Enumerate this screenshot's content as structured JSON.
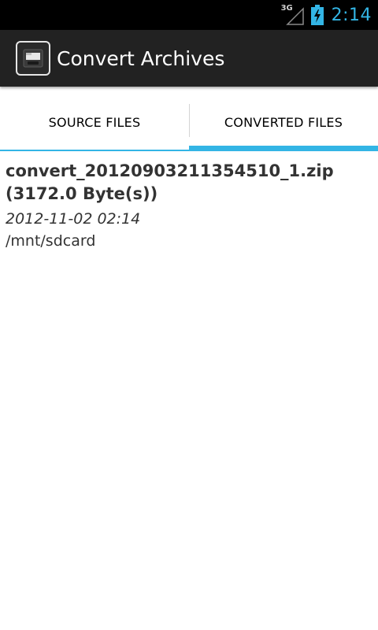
{
  "status_bar": {
    "network": "3G",
    "time": "2:14",
    "icons": [
      "signal-icon",
      "battery-charging-icon"
    ]
  },
  "action_bar": {
    "title": "Convert Archives",
    "icon": "archive-app-icon"
  },
  "tabs": [
    {
      "label": "SOURCE FILES",
      "selected": false
    },
    {
      "label": "CONVERTED FILES",
      "selected": true
    }
  ],
  "files": [
    {
      "name": "convert_20120903211354510_1.zip (3172.0 Byte(s))",
      "date": "2012-11-02 02:14",
      "path": "/mnt/sdcard"
    }
  ],
  "colors": {
    "accent": "#33b5e5",
    "action_bar": "#222222",
    "status_bar": "#000000"
  }
}
